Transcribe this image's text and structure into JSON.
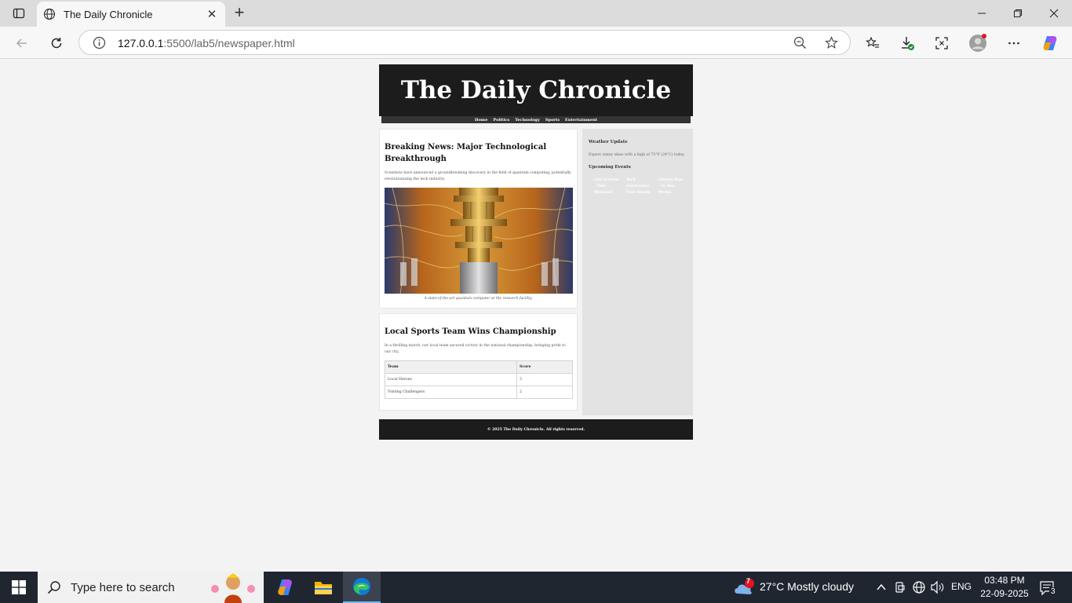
{
  "browser": {
    "tab_title": "The Daily Chronicle",
    "url_host": "127.0.0.1",
    "url_path": ":5500/lab5/newspaper.html"
  },
  "site": {
    "masthead": "The Daily Chronicle",
    "nav": [
      "Home",
      "Politics",
      "Technology",
      "Sports",
      "Entertainment"
    ],
    "articles": [
      {
        "headline": "Breaking News: Major Technological Breakthrough",
        "body": "Scientists have announced a groundbreaking discovery in the field of quantum computing, potentially revolutionizing the tech industry.",
        "caption": "A state-of-the-art quantum computer at the research facility."
      },
      {
        "headline": "Local Sports Team Wins Championship",
        "body": "In a thrilling match, our local team secured victory in the national championship, bringing pride to our city.",
        "table": {
          "headers": [
            "Team",
            "Score"
          ],
          "rows": [
            [
              "Local Heroes",
              "3"
            ],
            [
              "Visiting Challengers",
              "2"
            ]
          ]
        }
      }
    ],
    "sidebar": {
      "weather_title": "Weather Update",
      "weather_text": "Expect sunny skies with a high of 75°F (24°C) today.",
      "events_title": "Upcoming Events",
      "events": [
        "City Festival - This Weekend",
        "Tech Conference - Next Month",
        "Charity Run - In Two Weeks"
      ]
    },
    "footer": "© 2025 The Daily Chronicle. All rights reserved."
  },
  "taskbar": {
    "search_placeholder": "Type here to search",
    "weather_badge": "7",
    "weather": "27°C  Mostly cloudy",
    "lang": "ENG",
    "time": "03:48 PM",
    "date": "22-09-2025",
    "notifications": "3"
  },
  "colors": {
    "accent": "#1c1c1c",
    "sidebar": "#e3e3e3",
    "edge_blue": "#0078d4"
  }
}
